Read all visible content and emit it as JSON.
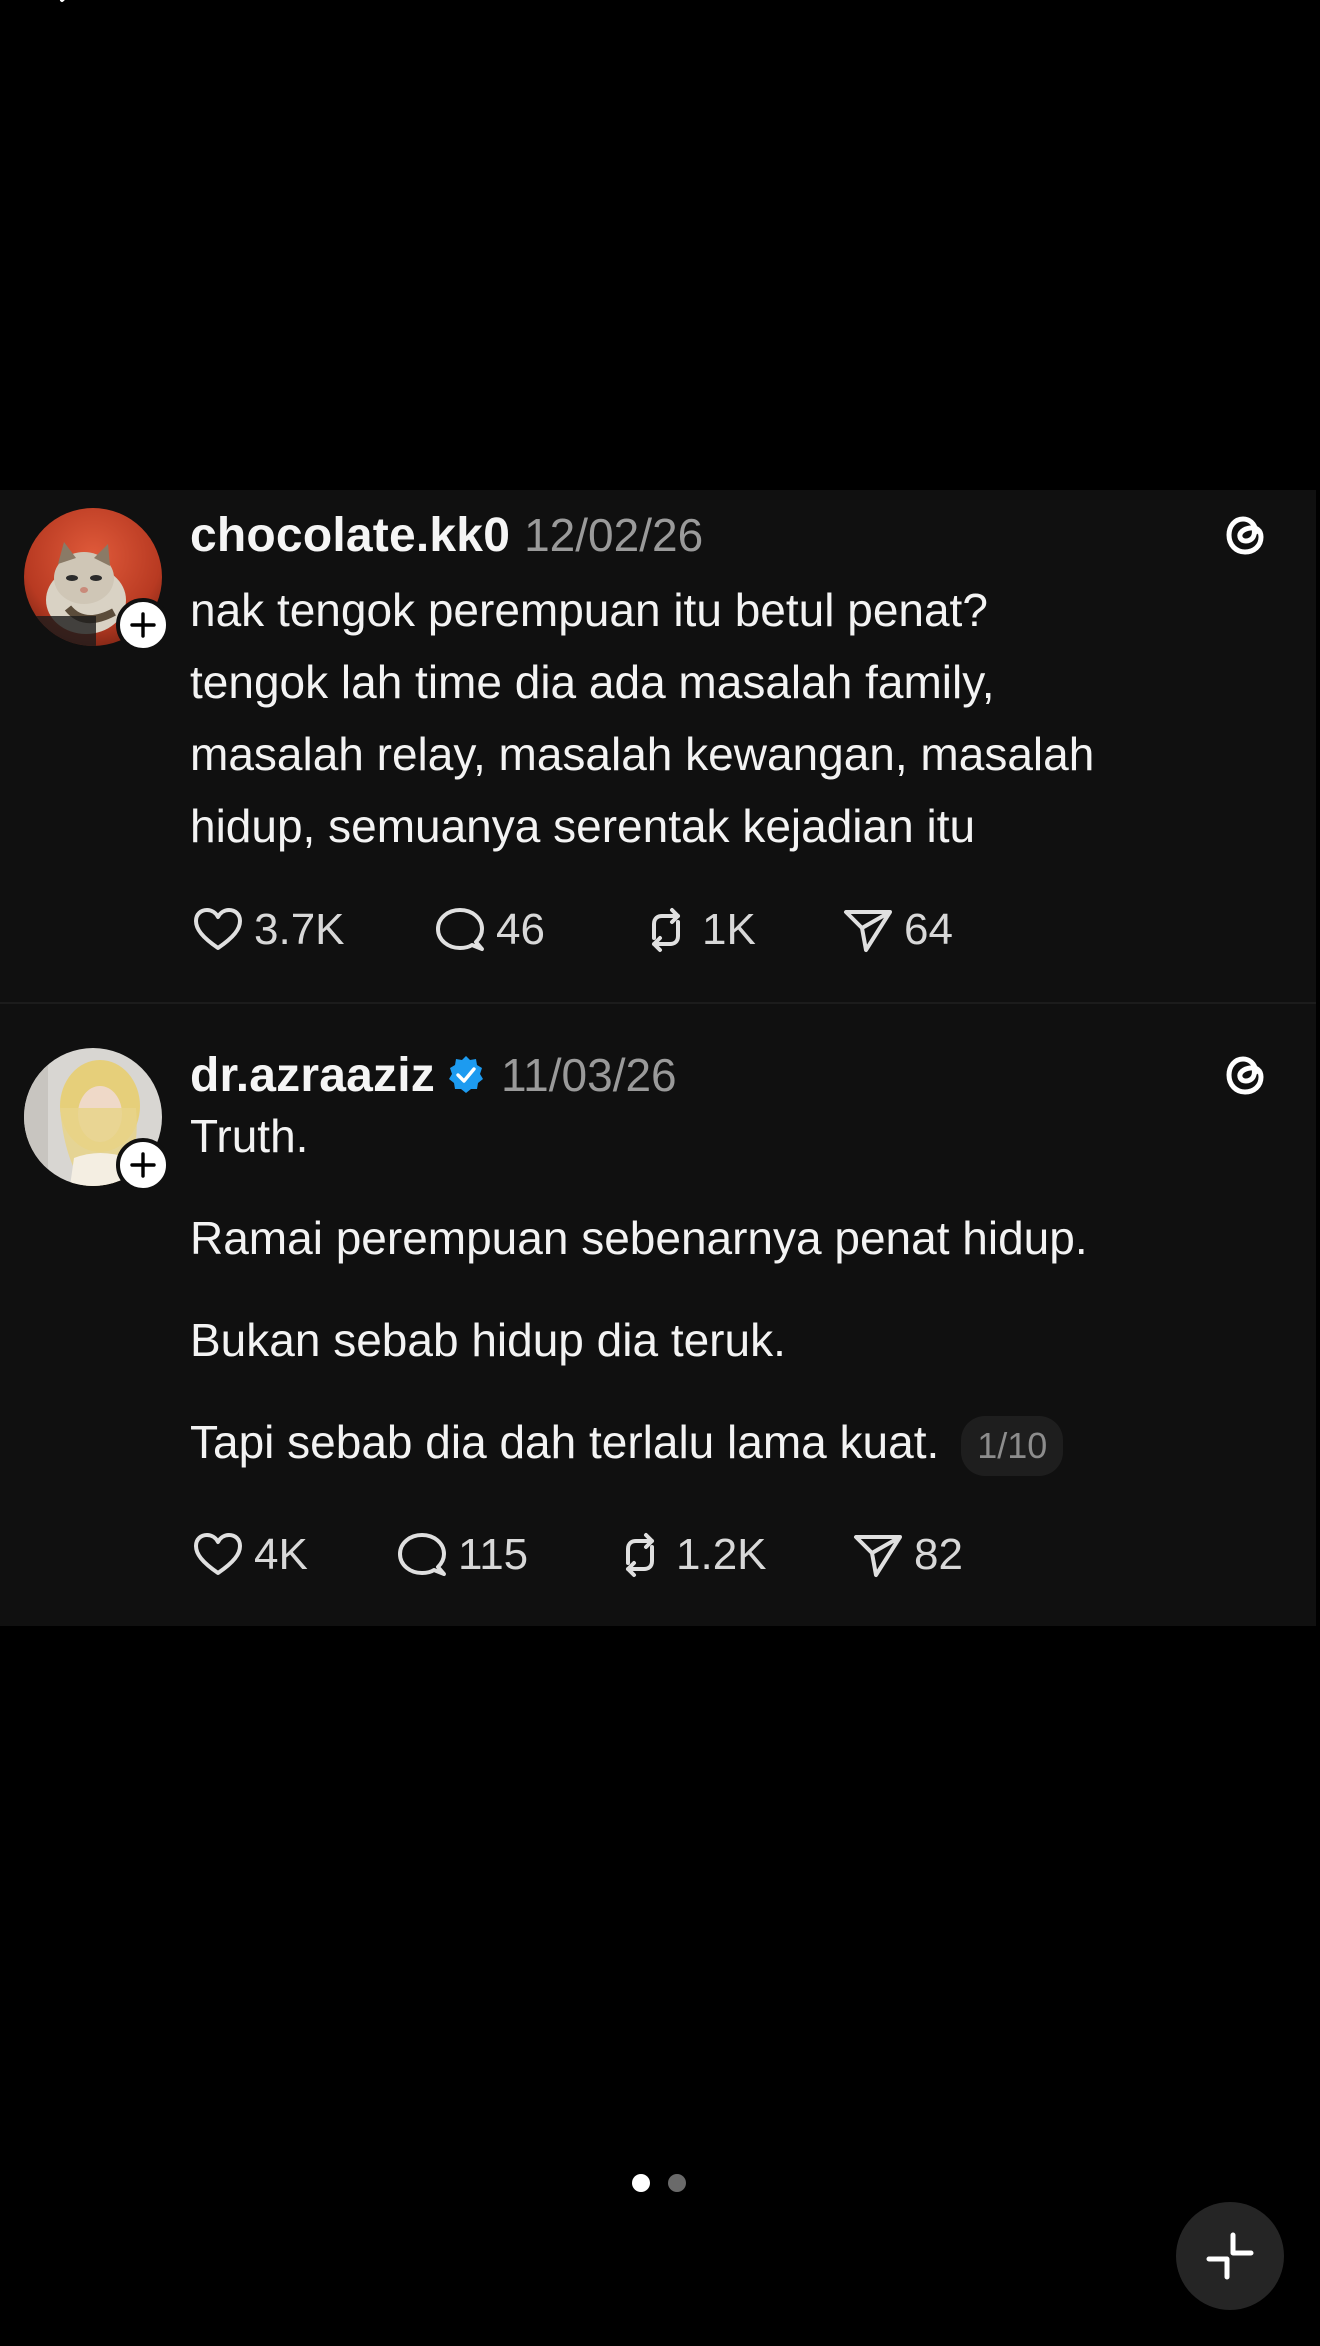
{
  "colors": {
    "background": "#000000",
    "card_background": "#101010",
    "verified_blue": "#1d9bf0",
    "muted_text": "#9a9a9a"
  },
  "posts": [
    {
      "username": "chocolate.kk0",
      "date": "12/02/26",
      "verified": false,
      "lines": [
        "nak tengok perempuan itu betul penat?",
        "tengok lah time dia ada masalah family,",
        "masalah relay, masalah kewangan, masalah",
        "hidup, semuanya serentak kejadian itu"
      ],
      "likes": "3.7K",
      "replies": "46",
      "reposts": "1K",
      "shares": "64"
    },
    {
      "username": "dr.azraaziz",
      "date": "11/03/26",
      "verified": true,
      "lines": [
        "Truth.",
        "Ramai perempuan sebenarnya penat hidup.",
        "Bukan sebab hidup dia teruk.",
        "Tapi sebab dia dah terlalu lama kuat."
      ],
      "thread_indicator": "1/10",
      "likes": "4K",
      "replies": "115",
      "reposts": "1.2K",
      "shares": "82"
    }
  ],
  "icons": {
    "back": "chevron-left-icon",
    "follow": "plus-icon",
    "threads": "threads-logo-icon",
    "like": "heart-icon",
    "reply": "comment-icon",
    "repost": "repost-icon",
    "share": "send-icon",
    "verified": "verified-badge-icon",
    "minimize": "minimize-icon"
  },
  "carousel": {
    "active_index": 0,
    "total": 2
  }
}
